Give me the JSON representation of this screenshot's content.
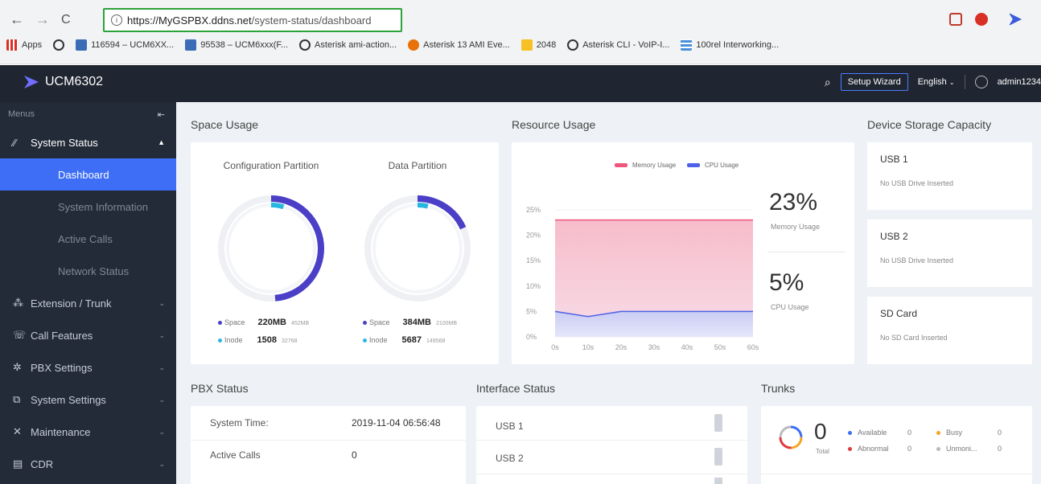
{
  "browser": {
    "url_host": "https://MyGSPBX.ddns.net",
    "url_path": "/system-status/dashboard",
    "bookmarks": [
      {
        "label": "Apps",
        "icon": "apps-grid-icon",
        "color": "#d93025"
      },
      {
        "label": "",
        "icon": "globe-icon",
        "color": "#333"
      },
      {
        "label": "116594 – UCM6XX...",
        "icon": "bookmark-image-icon",
        "color": "#3a6db5"
      },
      {
        "label": "95538 – UCM6xxx(F...",
        "icon": "bookmark-image-icon",
        "color": "#3a6db5"
      },
      {
        "label": "Asterisk ami-action...",
        "icon": "globe-icon",
        "color": "#333"
      },
      {
        "label": "Asterisk 13 AMI Eve...",
        "icon": "asterisk-icon",
        "color": "#e8710a"
      },
      {
        "label": "2048",
        "icon": "folder-icon",
        "color": "#f6c026"
      },
      {
        "label": "Asterisk CLI - VoIP-I...",
        "icon": "globe-icon",
        "color": "#333"
      },
      {
        "label": "100rel Interworking...",
        "icon": "grid-icon",
        "color": "#4a90d9"
      }
    ]
  },
  "header": {
    "app_name": "UCM6302",
    "setup_wizard": "Setup Wizard",
    "language": "English",
    "user": "admin1234"
  },
  "sidebar": {
    "menus_label": "Menus",
    "items": [
      {
        "label": "System Status",
        "icon": "activity-icon",
        "expanded": true
      },
      {
        "label": "Extension / Trunk",
        "icon": "extension-icon"
      },
      {
        "label": "Call Features",
        "icon": "phone-icon"
      },
      {
        "label": "PBX Settings",
        "icon": "gear-icon"
      },
      {
        "label": "System Settings",
        "icon": "settings-icon"
      },
      {
        "label": "Maintenance",
        "icon": "tools-icon"
      },
      {
        "label": "CDR",
        "icon": "cdr-icon"
      }
    ],
    "sub_items": [
      "Dashboard",
      "System Information",
      "Active Calls",
      "Network Status"
    ],
    "active_sub": "Dashboard"
  },
  "space_usage": {
    "title": "Space Usage",
    "partitions": [
      {
        "title": "Configuration Partition",
        "space_label": "Space",
        "space_value": "220MB",
        "space_total": "452MB",
        "inode_label": "Inode",
        "inode_value": "1508",
        "inode_total": "32768",
        "space_fraction": 0.487,
        "inode_fraction": 0.046
      },
      {
        "title": "Data Partition",
        "space_label": "Space",
        "space_value": "384MB",
        "space_total": "2100MB",
        "inode_label": "Inode",
        "inode_value": "5687",
        "inode_total": "149568",
        "space_fraction": 0.183,
        "inode_fraction": 0.038
      }
    ]
  },
  "resource_usage": {
    "title": "Resource Usage",
    "memory_value": "23%",
    "memory_label": "Memory Usage",
    "cpu_value": "5%",
    "cpu_label": "CPU Usage"
  },
  "chart_data": {
    "type": "area",
    "x": [
      0,
      10,
      20,
      30,
      40,
      50,
      60
    ],
    "x_tick_labels": [
      "0s",
      "10s",
      "20s",
      "30s",
      "40s",
      "50s",
      "60s"
    ],
    "y_tick_labels": [
      "25%",
      "20%",
      "15%",
      "10%",
      "5%",
      "0%"
    ],
    "ylim": [
      0,
      25
    ],
    "series": [
      {
        "name": "Memory Usage",
        "color": "#f0557c",
        "values": [
          23,
          23,
          23,
          23,
          23,
          23,
          23
        ]
      },
      {
        "name": "CPU Usage",
        "color": "#4d62e8",
        "values": [
          5,
          4,
          5,
          5,
          5,
          5,
          5
        ]
      }
    ],
    "legend": "top-center",
    "grid": true
  },
  "device_storage": {
    "title": "Device Storage Capacity",
    "items": [
      {
        "name": "USB 1",
        "status": "No USB Drive Inserted"
      },
      {
        "name": "USB 2",
        "status": "No USB Drive Inserted"
      },
      {
        "name": "SD Card",
        "status": "No SD Card Inserted"
      }
    ]
  },
  "pbx_status": {
    "title": "PBX Status",
    "rows": [
      {
        "label": "System Time:",
        "value": "2019-11-04 06:56:48"
      },
      {
        "label": "Active Calls",
        "value": "0"
      }
    ]
  },
  "interface_status": {
    "title": "Interface Status",
    "rows": [
      "USB 1",
      "USB 2"
    ]
  },
  "trunks": {
    "title": "Trunks",
    "total_value": "0",
    "total_label": "Total",
    "legend": [
      {
        "label": "Available",
        "value": "0",
        "color": "#3d6ef5"
      },
      {
        "label": "Busy",
        "value": "0",
        "color": "#f5a623"
      },
      {
        "label": "Abnormal",
        "value": "0",
        "color": "#e0393e"
      },
      {
        "label": "Unmoni...",
        "value": "0",
        "color": "#bbbbbb"
      }
    ]
  }
}
